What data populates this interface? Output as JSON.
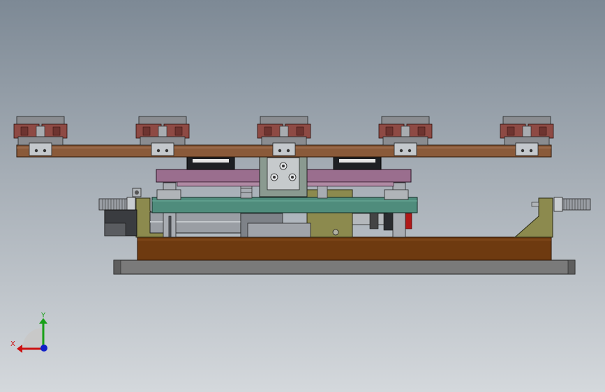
{
  "viewport": {
    "background_top": "#7d8995",
    "background_bottom": "#d4d8dc"
  },
  "colors": {
    "gripper_pad": "#8e4a44",
    "gripper_body": "#8a8c90",
    "top_rail": "#8a5a3a",
    "slide_plate": "#9a6e8e",
    "green_plate": "#4f8c7c",
    "olive_frame": "#8c8a4e",
    "base_block": "#6e3a10",
    "base_plate": "#7a7a7a",
    "cylinder": "#9a9ea4",
    "dark_part": "#222428"
  },
  "triad": {
    "x_label": "X",
    "y_label": "Y",
    "x_color": "#cc1010",
    "y_color": "#18a018",
    "z_color": "#1020c8"
  }
}
